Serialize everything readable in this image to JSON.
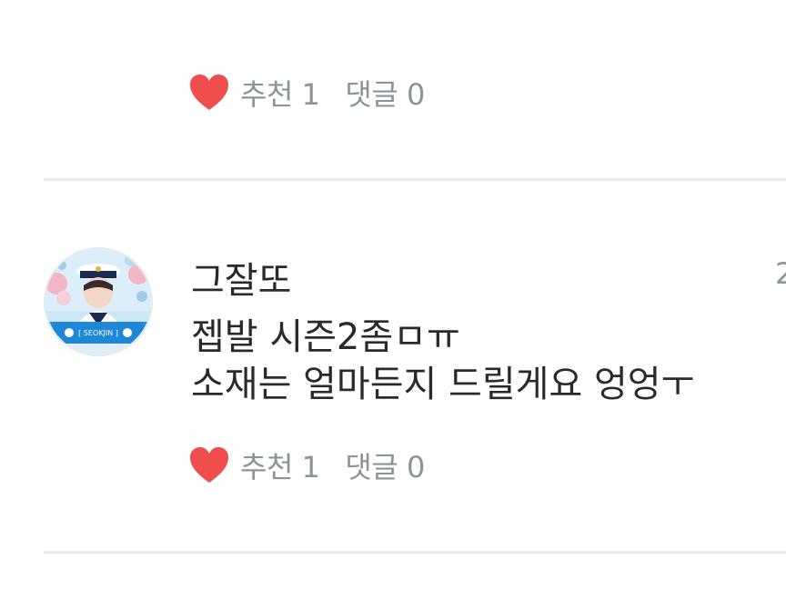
{
  "previous_comment": {
    "like_label": "추천 1",
    "reply_label": "댓글 0"
  },
  "comment": {
    "author": "그잘또",
    "date_partial": "2",
    "avatar_caption": "[ SEOKJIN ]",
    "lines": [
      "젭발 시즌2좀ㅁㅠ",
      "소재는 얼마든지 드릴게요 엉엉ㅜ"
    ],
    "like_label": "추천 1",
    "reply_label": "댓글 0"
  },
  "colors": {
    "heart": "#f04e4e",
    "meta_text": "#8b9599",
    "body_text": "#2a2a2a",
    "divider": "#e4ecec"
  },
  "icons": {
    "like": "heart-icon"
  }
}
